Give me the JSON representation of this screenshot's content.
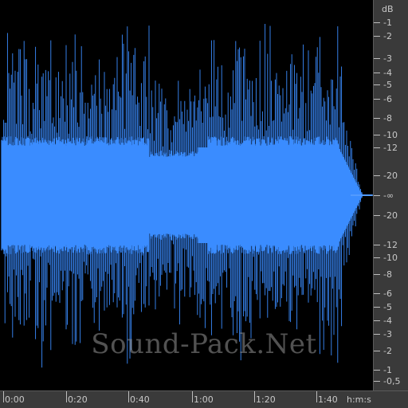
{
  "watermark": "Sound-Pack.Net",
  "colors": {
    "waveform": "#3a8cff",
    "waveform_light": "#6aa8ff",
    "background": "#000000",
    "ruler_bg": "#3a3a3a",
    "ruler_text": "#c8c8c8"
  },
  "db_ruler": {
    "unit": "dB",
    "upper_labels": [
      "-1",
      "-2",
      "-3",
      "-4",
      "-5",
      "-6",
      "-8",
      "-10",
      "-12",
      "-20"
    ],
    "center_label": "-∞",
    "lower_labels": [
      "-20",
      "-12",
      "-10",
      "-8",
      "-6",
      "-5",
      "-4",
      "-3",
      "-2",
      "-1",
      "-0,5"
    ]
  },
  "time_ruler": {
    "unit": "h:m:s",
    "labels": [
      "0:00",
      "0:20",
      "0:40",
      "1:00",
      "1:20",
      "1:40"
    ]
  }
}
